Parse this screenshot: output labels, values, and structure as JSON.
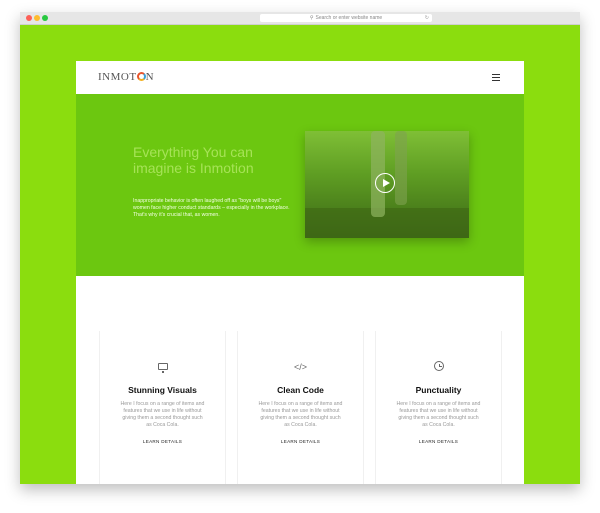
{
  "browser": {
    "url_placeholder": "Search or enter website name"
  },
  "nav": {
    "logo_text_left": "INMOT",
    "logo_text_right": "N"
  },
  "hero": {
    "title": "Everything You can imagine is Inmotion",
    "text": "Inappropriate behavior is often laughed off as \"boys will be boys\" women face higher conduct standards – especially in the workplace. That's why it's crucial that, as women."
  },
  "features": [
    {
      "icon": "monitor-icon",
      "title": "Stunning Visuals",
      "text": "Here I focus on a range of items and features that we use in life without giving them a second thought such as Coca Cola.",
      "link": "LEARN DETAILS"
    },
    {
      "icon": "code-icon",
      "title": "Clean Code",
      "text": "Here I focus on a range of items and features that we use in life without giving them a second thought such as Coca Cola.",
      "link": "LEARN DETAILS"
    },
    {
      "icon": "clock-icon",
      "title": "Punctuality",
      "text": "Here I focus on a range of items and features that we use in life without giving them a second thought such as Coca Cola.",
      "link": "LEARN DETAILS"
    }
  ],
  "colors": {
    "frame_bg": "#8bdd0e",
    "hero_bg": "#6cc710",
    "hero_title": "#a6e357"
  }
}
